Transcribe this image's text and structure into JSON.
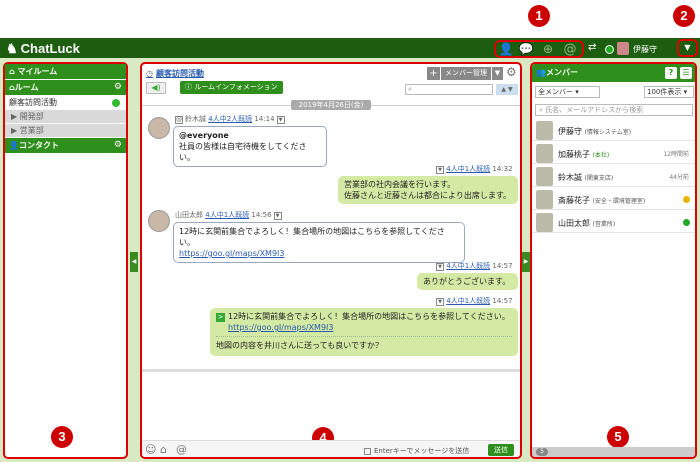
{
  "app": {
    "name": "ChatLuck",
    "user": "伊藤守"
  },
  "badges": [
    "1",
    "2",
    "3",
    "4",
    "5"
  ],
  "top_icons": [
    "user-icon",
    "chat-icon",
    "globe-icon",
    "at-icon"
  ],
  "sidebar": {
    "my_room": "マイルーム",
    "room": "ルーム",
    "rooms": [
      {
        "label": "顧客訪問活動"
      }
    ],
    "groups": [
      "開発部",
      "営業部"
    ],
    "contact": "コンタクト"
  },
  "room": {
    "title": "顧客訪問活動",
    "info_button": "ルームインフォメーション",
    "member_button": "メンバー管理",
    "date": "2019年4月26日(金)"
  },
  "messages": [
    {
      "sender": "鈴木誠",
      "read": "4人中2人既読",
      "time": "14:14",
      "lines": [
        "@everyone",
        "社員の皆様は自宅待機をしてください。"
      ]
    },
    {
      "read": "4人中1人既読",
      "time": "14:32",
      "lines": [
        "営業部の社内会議を行います。",
        "佐藤さんと近藤さんは都合により出席します。"
      ]
    },
    {
      "sender": "山田太郎",
      "read": "4人中1人既読",
      "time": "14:56",
      "lines": [
        "12時に玄関前集合でよろしく！集合場所の地図はこちらを参照してください。"
      ],
      "link": "https://goo.gl/maps/XM9I3"
    },
    {
      "read": "4人中1人既読",
      "time": "14:57",
      "lines": [
        "ありがとうございます。"
      ]
    },
    {
      "read": "4人中1人既読",
      "time": "14:57",
      "quote": "12時に玄関前集合でよろしく！集合場所の地図はこちらを参照してください。",
      "link": "https://goo.gl/maps/XM9I3",
      "reply": "地図の内容を井川さんに送っても良いですか？"
    }
  ],
  "compose": {
    "enter_label": "Enterキーでメッセージを送信",
    "send": "送信"
  },
  "members_panel": {
    "title": "メンバー",
    "filter": "全メンバー",
    "per_page": "100件表示",
    "search_placeholder": "氏名、メールアドレスから検索",
    "count": "5",
    "members": [
      {
        "name": "伊藤守",
        "dept": "(情報システム室)",
        "time": ""
      },
      {
        "name": "加藤桃子",
        "dept": "(本社)",
        "time": "12時間前"
      },
      {
        "name": "鈴木誠",
        "dept": "(関東支店)",
        "time": "44分前"
      },
      {
        "name": "斎藤花子",
        "dept": "(安全・環境管理室)",
        "time": ""
      },
      {
        "name": "山田太郎",
        "dept": "(営業所)",
        "time": ""
      }
    ]
  },
  "colors": {
    "header": "#1d5d0f",
    "accent": "#2f8f1c",
    "highlight": "#d00000",
    "bubble": "#d4eaa4"
  }
}
